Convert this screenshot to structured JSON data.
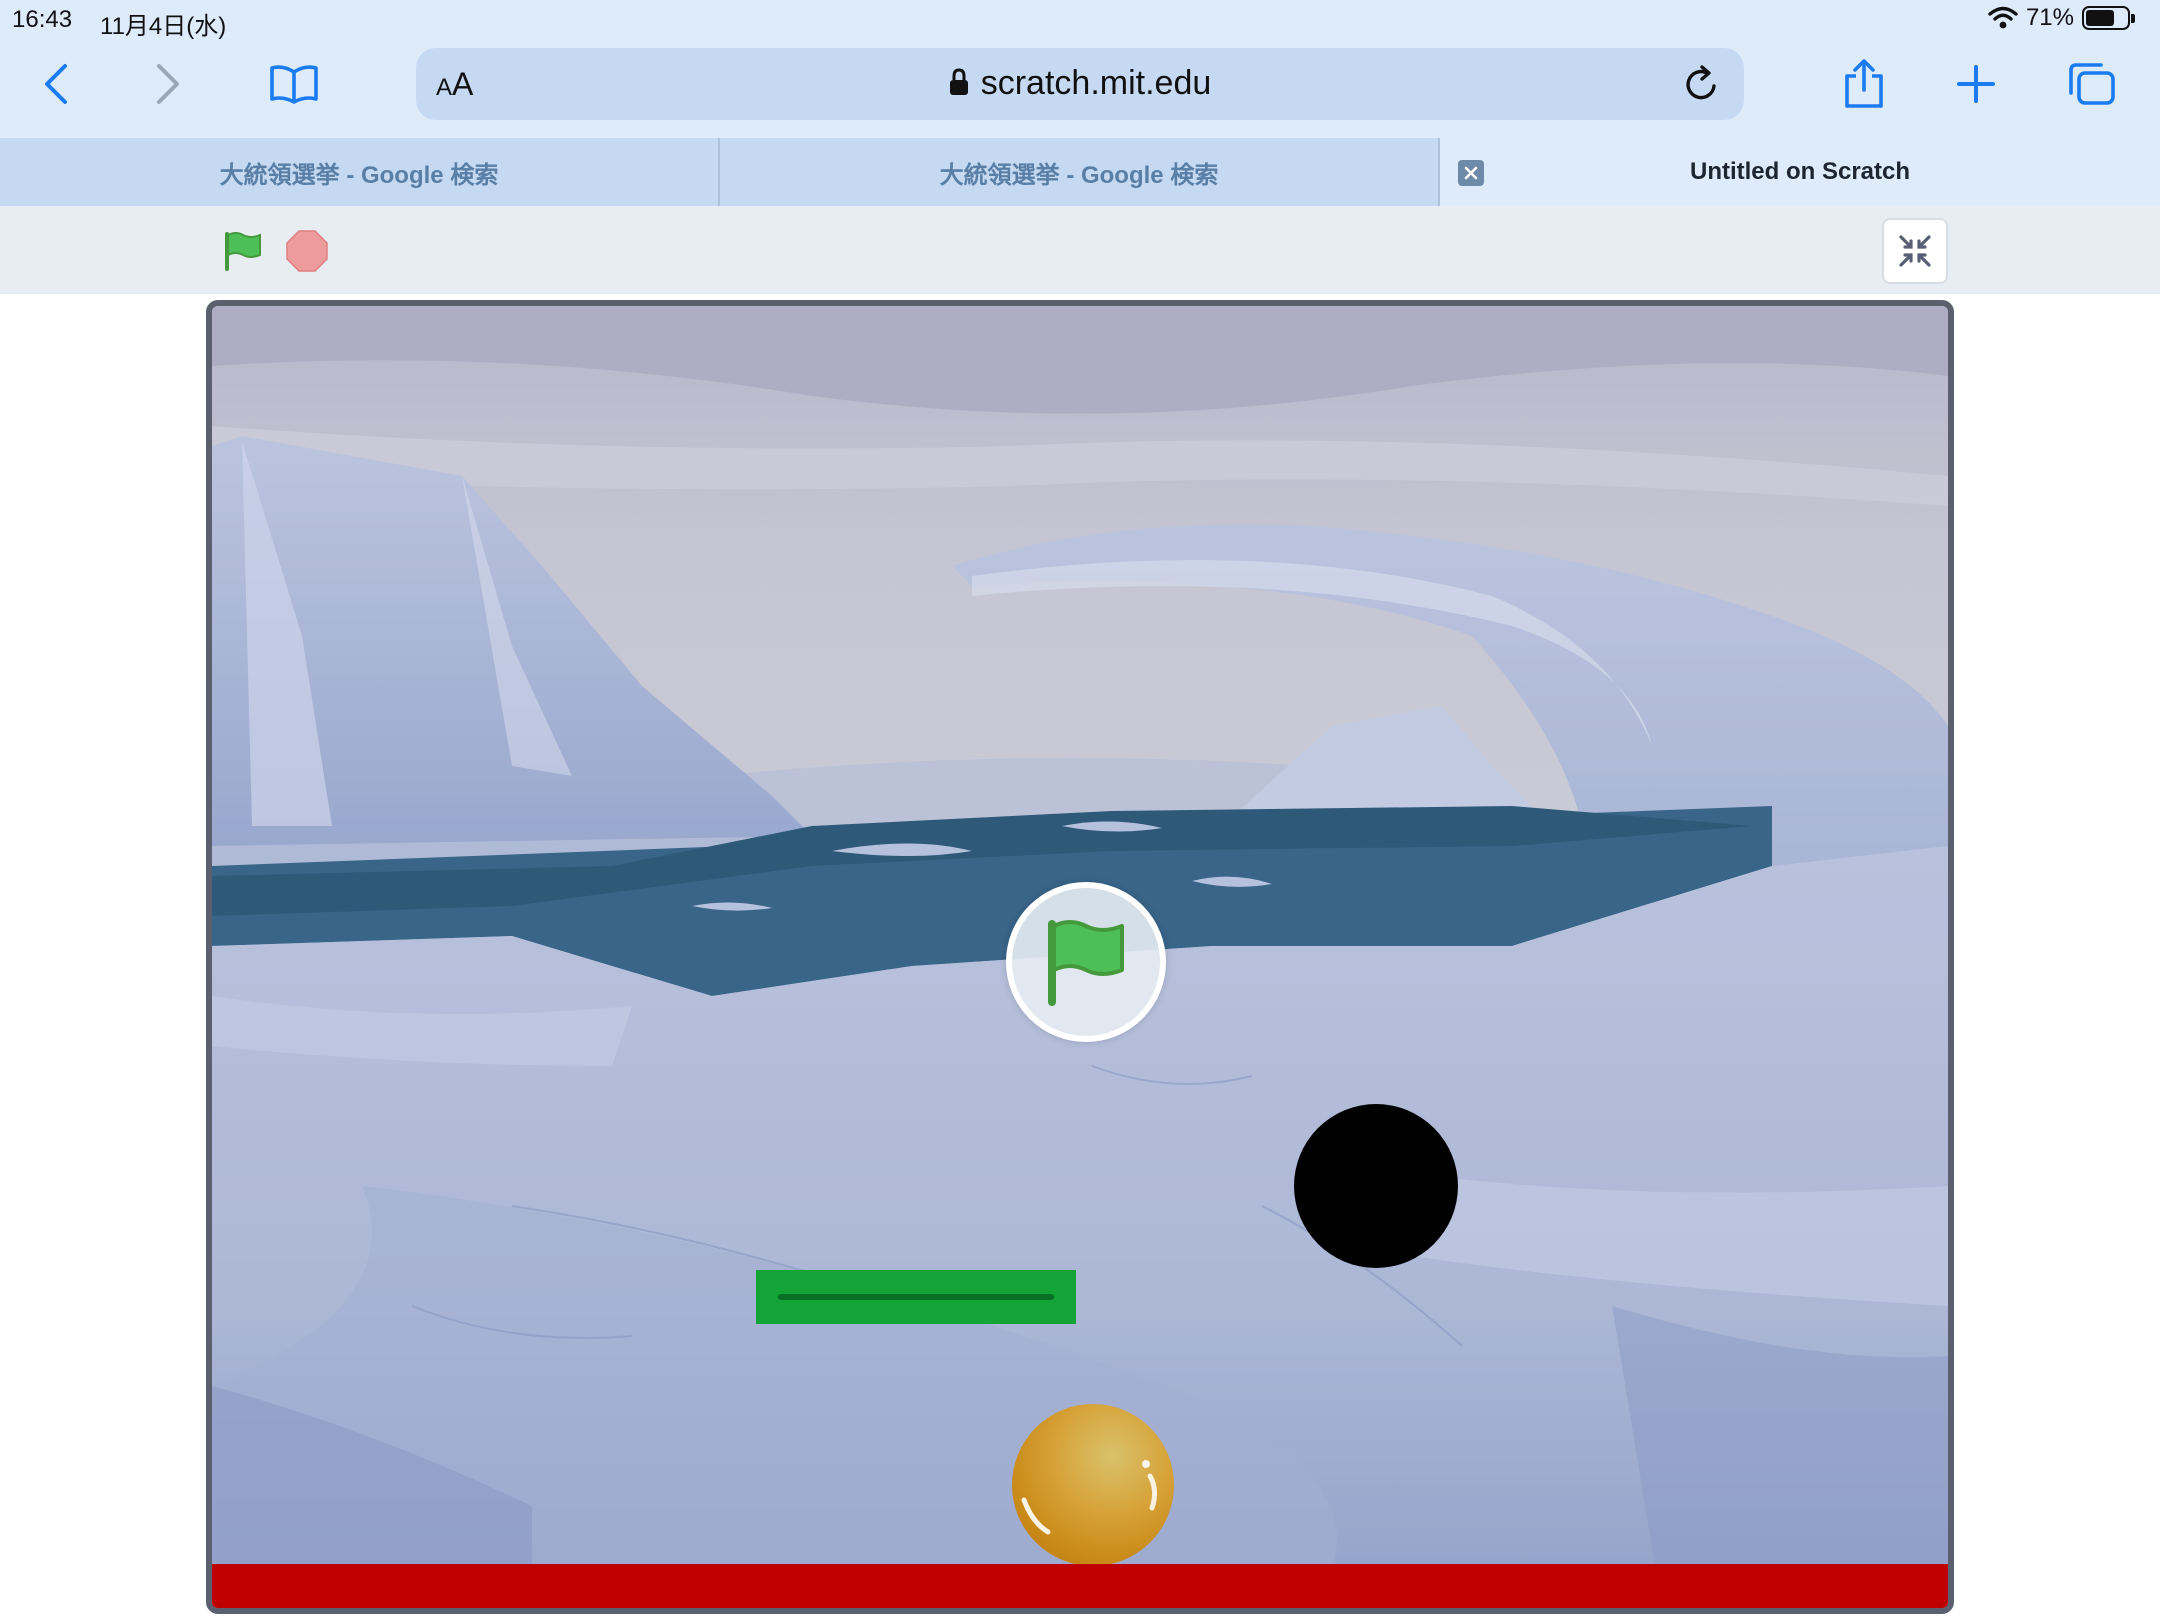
{
  "status_bar": {
    "time": "16:43",
    "date": "11月4日(水)",
    "battery_label": "71%",
    "battery_level": 0.71
  },
  "toolbar": {
    "aa_small": "A",
    "aa_large": "A",
    "url": "scratch.mit.edu",
    "accent_color": "#1a7cf0"
  },
  "tabs": [
    {
      "title": "大統領選挙 - Google 検索",
      "active": false
    },
    {
      "title": "大統領選挙 - Google 検索",
      "active": false
    },
    {
      "title": "Untitled on Scratch",
      "active": true
    }
  ],
  "player": {
    "green_flag_color": "#4cbf56",
    "stop_color": "#ec9c9c",
    "sprites": [
      "paddle",
      "black-ball",
      "golden-ball",
      "floor-bar"
    ],
    "overlay": "green-flag"
  },
  "icons": [
    "back-icon",
    "forward-icon",
    "bookmarks-icon",
    "lock-icon",
    "reload-icon",
    "share-icon",
    "plus-icon",
    "tabs-icon",
    "wifi-icon",
    "battery-icon",
    "green-flag-icon",
    "stop-icon",
    "unfullscreen-icon"
  ]
}
